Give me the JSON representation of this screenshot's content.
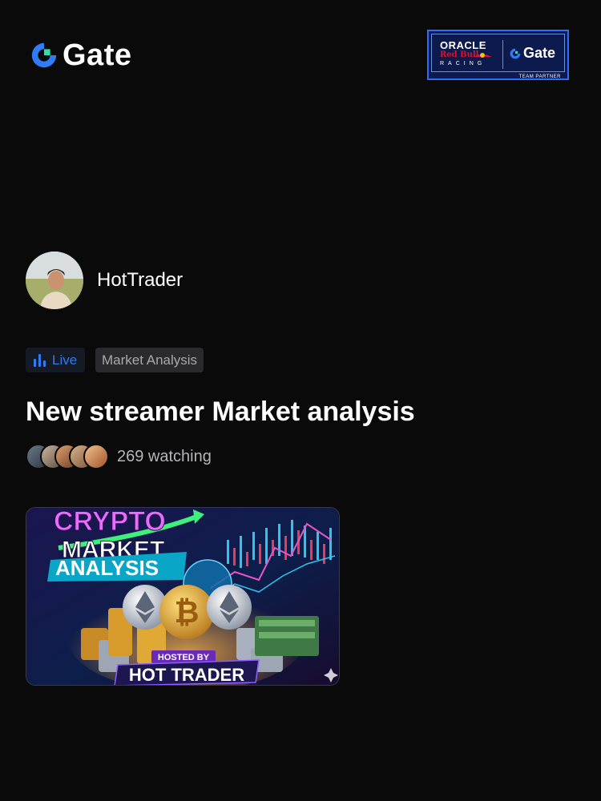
{
  "header": {
    "logo_text": "Gate",
    "partner": {
      "oracle": "ORACLE",
      "redbull": "Red Bull",
      "racing": "RACING",
      "gate": "Gate",
      "team": "TEAM PARTNER"
    }
  },
  "streamer": {
    "name": "HotTrader"
  },
  "tags": {
    "live": "Live",
    "category": "Market Analysis"
  },
  "stream": {
    "title": "New streamer Market analysis",
    "watching": "269 watching"
  },
  "thumbnail": {
    "line1": "CRYPTO",
    "line2": "MARKET",
    "line3": "ANALYSIS",
    "hosted_by": "HOSTED BY",
    "host": "HOT TRADER"
  },
  "colors": {
    "accent_blue": "#2f7cf6",
    "background": "#0a0a0b"
  }
}
